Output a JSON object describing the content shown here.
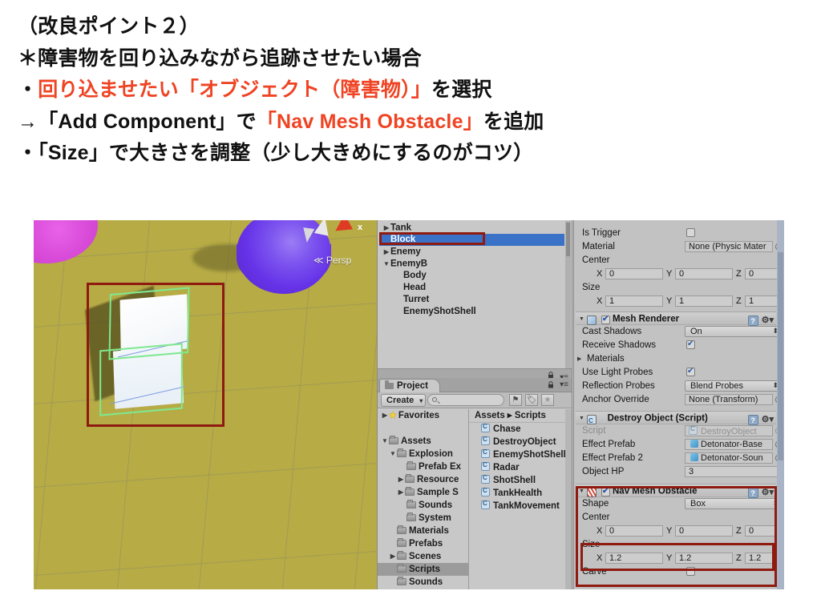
{
  "slide": {
    "lines": [
      {
        "segments": [
          {
            "text": "（改良ポイント２）",
            "accent": false
          }
        ]
      },
      {
        "segments": [
          {
            "text": "＊障害物を回り込みながら追跡させたい場合",
            "accent": false
          }
        ]
      },
      {
        "segments": [
          {
            "text": "・",
            "accent": false
          },
          {
            "text": "回り込ませたい「オブジェクト（障害物）」",
            "accent": true
          },
          {
            "text": "を選択",
            "accent": false
          }
        ]
      },
      {
        "segments": [
          {
            "text": "→「Add Component」で",
            "accent": false
          },
          {
            "text": "「Nav Mesh Obstacle」",
            "accent": true
          },
          {
            "text": "を追加",
            "accent": false
          }
        ]
      },
      {
        "segments": [
          {
            "text": "・「Size」で大きさを調整（少し大きめにするのがコツ）",
            "accent": false
          }
        ]
      }
    ],
    "accent_color": "#ef4323",
    "text_color": "#111111"
  },
  "scene": {
    "projection_label": "Persp",
    "gizmo_axis_label": "x",
    "ground_color": "#b6ab45",
    "obstacle_wire_color": "#7fe890",
    "annotation_color": "#8e1a10"
  },
  "hierarchy": {
    "items": [
      {
        "label": "Tank",
        "indent": 0,
        "arrow": "collapsed",
        "selected": false
      },
      {
        "label": "Block",
        "indent": 0,
        "arrow": "none",
        "selected": true
      },
      {
        "label": "Enemy",
        "indent": 0,
        "arrow": "collapsed",
        "selected": false
      },
      {
        "label": "EnemyB",
        "indent": 0,
        "arrow": "expanded",
        "selected": false
      },
      {
        "label": "Body",
        "indent": 1,
        "arrow": "none",
        "selected": false
      },
      {
        "label": "Head",
        "indent": 1,
        "arrow": "none",
        "selected": false
      },
      {
        "label": "Turret",
        "indent": 1,
        "arrow": "none",
        "selected": false
      },
      {
        "label": "EnemyShotShell",
        "indent": 1,
        "arrow": "none",
        "selected": false
      }
    ],
    "selection_color": "#3a72c8"
  },
  "project": {
    "tab_label": "Project",
    "create_label": "Create",
    "search_placeholder": "",
    "search_value": "",
    "breadcrumb": "Assets  ▸  Scripts",
    "folders": [
      {
        "label": "Favorites",
        "indent": 0,
        "arrow": "collapsed",
        "icon": "star",
        "selected": false
      },
      {
        "label": "",
        "indent": 0,
        "arrow": "none",
        "icon": "none",
        "selected": false
      },
      {
        "label": "Assets",
        "indent": 0,
        "arrow": "expanded",
        "icon": "folder",
        "selected": false
      },
      {
        "label": "Explosion",
        "indent": 1,
        "arrow": "expanded",
        "icon": "folder",
        "selected": false
      },
      {
        "label": "Prefab Ex",
        "indent": 2,
        "arrow": "none",
        "icon": "folder",
        "selected": false
      },
      {
        "label": "Resource",
        "indent": 2,
        "arrow": "collapsed",
        "icon": "folder",
        "selected": false
      },
      {
        "label": "Sample S",
        "indent": 2,
        "arrow": "collapsed",
        "icon": "folder",
        "selected": false
      },
      {
        "label": "Sounds",
        "indent": 2,
        "arrow": "none",
        "icon": "folder",
        "selected": false
      },
      {
        "label": "System",
        "indent": 2,
        "arrow": "none",
        "icon": "folder",
        "selected": false
      },
      {
        "label": "Materials",
        "indent": 1,
        "arrow": "none",
        "icon": "folder",
        "selected": false
      },
      {
        "label": "Prefabs",
        "indent": 1,
        "arrow": "none",
        "icon": "folder",
        "selected": false
      },
      {
        "label": "Scenes",
        "indent": 1,
        "arrow": "collapsed",
        "icon": "folder",
        "selected": false
      },
      {
        "label": "Scripts",
        "indent": 1,
        "arrow": "none",
        "icon": "folder",
        "selected": true
      },
      {
        "label": "Sounds",
        "indent": 1,
        "arrow": "none",
        "icon": "folder",
        "selected": false
      }
    ],
    "assets": [
      {
        "label": "Chase"
      },
      {
        "label": "DestroyObject"
      },
      {
        "label": "EnemyShotShell"
      },
      {
        "label": "Radar"
      },
      {
        "label": "ShotShell"
      },
      {
        "label": "TankHealth"
      },
      {
        "label": "TankMovement"
      }
    ]
  },
  "inspector": {
    "box_collider": {
      "is_trigger_label": "Is Trigger",
      "is_trigger_checked": false,
      "material_label": "Material",
      "material_value": "None (Physic Mater",
      "center_label": "Center",
      "center": {
        "x": "0",
        "y": "0",
        "z": "0"
      },
      "size_label": "Size",
      "size": {
        "x": "1",
        "y": "1",
        "z": "1"
      }
    },
    "mesh_renderer": {
      "title": "Mesh Renderer",
      "enabled": true,
      "cast_shadows_label": "Cast Shadows",
      "cast_shadows_value": "On",
      "receive_shadows_label": "Receive Shadows",
      "receive_shadows_checked": true,
      "materials_label": "Materials",
      "use_light_probes_label": "Use Light Probes",
      "use_light_probes_checked": true,
      "reflection_probes_label": "Reflection Probes",
      "reflection_probes_value": "Blend Probes",
      "anchor_override_label": "Anchor Override",
      "anchor_override_value": "None (Transform)"
    },
    "destroy_object": {
      "title": "Destroy Object (Script)",
      "script_label": "Script",
      "script_value": "DestroyObject",
      "effect_prefab_label": "Effect Prefab",
      "effect_prefab_value": "Detonator-Base",
      "effect_prefab2_label": "Effect Prefab 2",
      "effect_prefab2_value": "Detonator-Soun",
      "object_hp_label": "Object HP",
      "object_hp_value": "3"
    },
    "nav_mesh_obstacle": {
      "title": "Nav Mesh Obstacle",
      "enabled": true,
      "shape_label": "Shape",
      "shape_value": "Box",
      "center_label": "Center",
      "center": {
        "x": "0",
        "y": "0",
        "z": "0"
      },
      "size_label": "Size",
      "size": {
        "x": "1.2",
        "y": "1.2",
        "z": "1.2"
      },
      "carve_label": "Carve",
      "carve_checked": false
    },
    "axis_labels": {
      "x": "X",
      "y": "Y",
      "z": "Z"
    }
  }
}
